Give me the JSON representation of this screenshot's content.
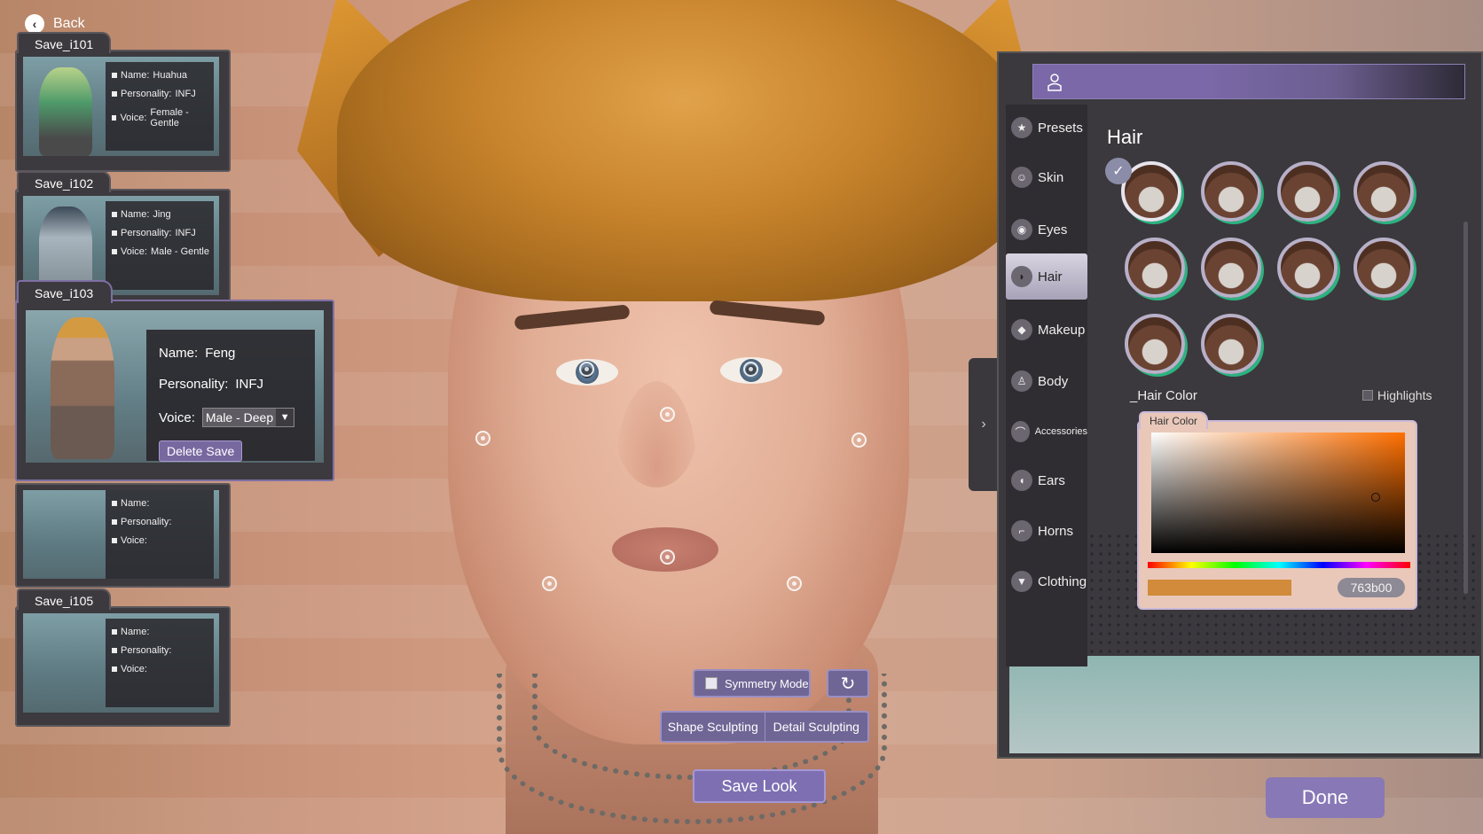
{
  "navigation": {
    "back_label": "Back"
  },
  "saves": [
    {
      "tab": "Save_i101",
      "name_label": "Name:",
      "name": "Huahua",
      "personality_label": "Personality:",
      "personality": "INFJ",
      "voice_label": "Voice:",
      "voice": "Female - Gentle"
    },
    {
      "tab": "Save_i102",
      "name_label": "Name:",
      "name": "Jing",
      "personality_label": "Personality:",
      "personality": "INFJ",
      "voice_label": "Voice:",
      "voice": "Male - Gentle"
    },
    {
      "tab": "",
      "name_label": "Name:",
      "name": "",
      "personality_label": "Personality:",
      "personality": "",
      "voice_label": "Voice:",
      "voice": ""
    },
    {
      "tab": "Save_i105",
      "name_label": "Name:",
      "name": "",
      "personality_label": "Personality:",
      "personality": "",
      "voice_label": "Voice:",
      "voice": ""
    }
  ],
  "selected_save": {
    "tab": "Save_i103",
    "name_label": "Name:",
    "name": "Feng",
    "personality_label": "Personality:",
    "personality": "INFJ",
    "voice_label": "Voice:",
    "voice": "Male - Deep",
    "delete_label": "Delete Save"
  },
  "controls": {
    "symmetry_label": "Symmetry Mode",
    "shape_sculpting_label": "Shape Sculpting",
    "detail_sculpting_label": "Detail Sculpting",
    "save_look_label": "Save Look",
    "done_label": "Done"
  },
  "panel": {
    "nav": [
      {
        "label": "Presets",
        "icon": "star-icon"
      },
      {
        "label": "Skin",
        "icon": "face-icon"
      },
      {
        "label": "Eyes",
        "icon": "eye-icon"
      },
      {
        "label": "Hair",
        "icon": "hair-icon",
        "active": true
      },
      {
        "label": "Makeup",
        "icon": "makeup-icon"
      },
      {
        "label": "Body",
        "icon": "body-icon"
      },
      {
        "label": "Accessories",
        "icon": "hat-icon"
      },
      {
        "label": "Ears",
        "icon": "ear-icon"
      },
      {
        "label": "Horns",
        "icon": "horn-icon"
      },
      {
        "label": "Clothing",
        "icon": "shirt-icon"
      }
    ],
    "section_title": "Hair",
    "hair_style_count": 10,
    "selected_hair_index": 0,
    "hair_color_label": "_Hair Color",
    "highlights_label": "Highlights",
    "picker_title": "Hair Color",
    "hex_value": "763b00"
  },
  "colors": {
    "accent": "#7d6fb2",
    "hair_preview": "#d28b3a",
    "swatch_ring": "#2db280"
  }
}
